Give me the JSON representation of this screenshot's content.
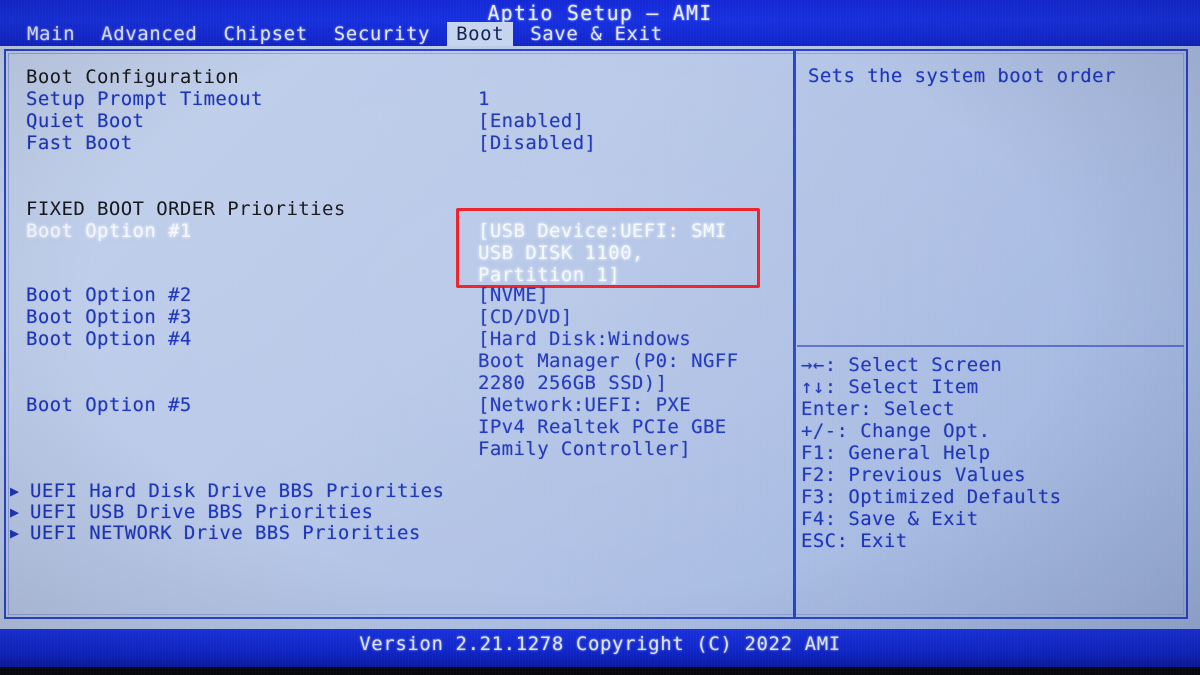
{
  "header": {
    "title": "Aptio Setup – AMI",
    "tabs": [
      {
        "label": "Main",
        "active": false
      },
      {
        "label": "Advanced",
        "active": false
      },
      {
        "label": "Chipset",
        "active": false
      },
      {
        "label": "Security",
        "active": false
      },
      {
        "label": "Boot",
        "active": true
      },
      {
        "label": "Save & Exit",
        "active": false
      }
    ]
  },
  "main": {
    "section_boot_config": "Boot Configuration",
    "settings": [
      {
        "label": "Setup Prompt Timeout",
        "value": "1"
      },
      {
        "label": "Quiet Boot",
        "value": "[Enabled]"
      },
      {
        "label": "Fast Boot",
        "value": "[Disabled]"
      }
    ],
    "section_fixed_order": "FIXED BOOT ORDER Priorities",
    "boot_options": [
      {
        "label": "Boot Option #1",
        "selected": true,
        "value_lines": [
          "[USB Device:UEFI: SMI",
          "USB DISK 1100,",
          "Partition 1]"
        ]
      },
      {
        "label": "Boot Option #2",
        "selected": false,
        "value_lines": [
          "[NVME]"
        ]
      },
      {
        "label": "Boot Option #3",
        "selected": false,
        "value_lines": [
          "[CD/DVD]"
        ]
      },
      {
        "label": "Boot Option #4",
        "selected": false,
        "value_lines": [
          "[Hard Disk:Windows",
          "Boot Manager (P0: NGFF",
          "2280 256GB SSD)]"
        ]
      },
      {
        "label": "Boot Option #5",
        "selected": false,
        "value_lines": [
          "[Network:UEFI: PXE",
          "IPv4 Realtek PCIe GBE",
          "Family Controller]"
        ]
      }
    ],
    "submenus": [
      {
        "marker": "▶",
        "label": "UEFI Hard Disk Drive BBS Priorities"
      },
      {
        "marker": "▶",
        "label": "UEFI USB Drive BBS Priorities"
      },
      {
        "marker": "▶",
        "label": "UEFI NETWORK Drive BBS Priorities"
      }
    ]
  },
  "help_panel": {
    "description": "Sets the system boot order",
    "keys": [
      {
        "key": "→←",
        "action": ": Select Screen"
      },
      {
        "key": "↑↓",
        "action": ": Select Item"
      },
      {
        "key": "Enter",
        "action": ": Select"
      },
      {
        "key": "+/-",
        "action": ": Change Opt."
      },
      {
        "key": "F1",
        "action": ": General Help"
      },
      {
        "key": "F2",
        "action": ": Previous Values"
      },
      {
        "key": "F3",
        "action": ": Optimized Defaults"
      },
      {
        "key": "F4",
        "action": ": Save & Exit"
      },
      {
        "key": "ESC",
        "action": ": Exit"
      }
    ]
  },
  "footer": {
    "version_text": "Version 2.21.1278 Copyright (C) 2022 AMI"
  },
  "annotation": {
    "highlight_color": "#ed1c24",
    "target": "Boot Option #1 value"
  }
}
